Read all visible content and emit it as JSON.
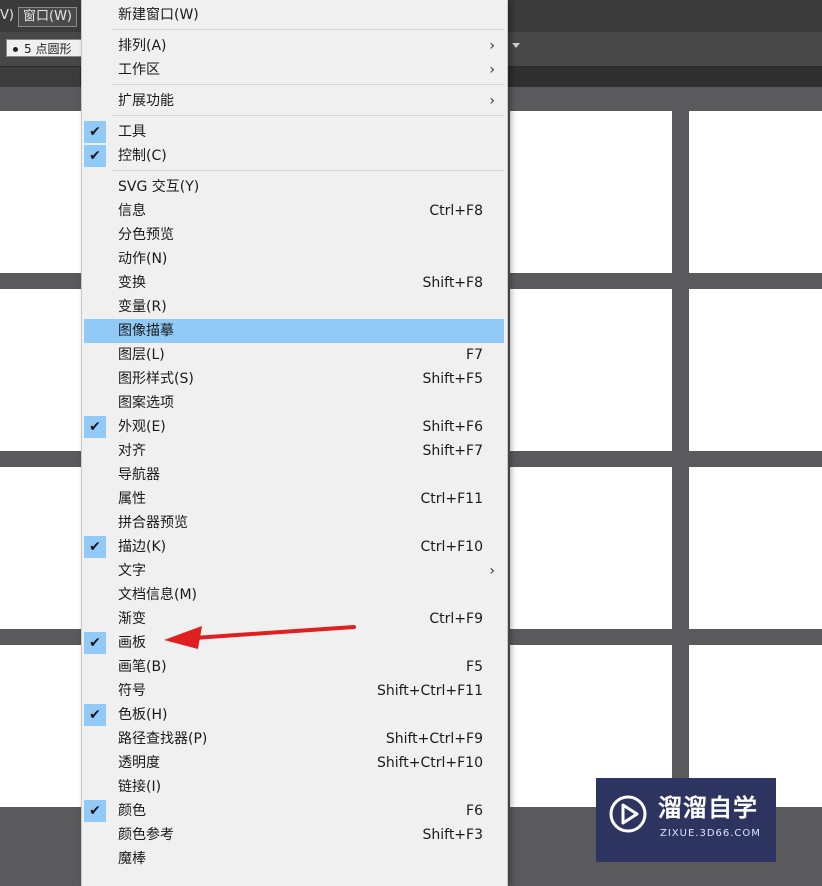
{
  "menubar": {
    "view_fragment": "V)",
    "window_label": "窗口(W)"
  },
  "controlbar": {
    "brush_label": "5 点圆形"
  },
  "menu": {
    "items": [
      {
        "label": "新建窗口(W)",
        "shortcut": "",
        "checked": false,
        "submenu": false
      },
      {
        "label": "排列(A)",
        "shortcut": "",
        "checked": false,
        "submenu": true
      },
      {
        "label": "工作区",
        "shortcut": "",
        "checked": false,
        "submenu": true
      },
      {
        "label": "扩展功能",
        "shortcut": "",
        "checked": false,
        "submenu": true
      },
      {
        "label": "工具",
        "shortcut": "",
        "checked": true,
        "submenu": false
      },
      {
        "label": "控制(C)",
        "shortcut": "",
        "checked": true,
        "submenu": false
      },
      {
        "label": "SVG 交互(Y)",
        "shortcut": "",
        "checked": false,
        "submenu": false
      },
      {
        "label": "信息",
        "shortcut": "Ctrl+F8",
        "checked": false,
        "submenu": false
      },
      {
        "label": "分色预览",
        "shortcut": "",
        "checked": false,
        "submenu": false
      },
      {
        "label": "动作(N)",
        "shortcut": "",
        "checked": false,
        "submenu": false
      },
      {
        "label": "变换",
        "shortcut": "Shift+F8",
        "checked": false,
        "submenu": false
      },
      {
        "label": "变量(R)",
        "shortcut": "",
        "checked": false,
        "submenu": false
      },
      {
        "label": "图像描摹",
        "shortcut": "",
        "checked": false,
        "submenu": false,
        "highlighted": true
      },
      {
        "label": "图层(L)",
        "shortcut": "F7",
        "checked": false,
        "submenu": false
      },
      {
        "label": "图形样式(S)",
        "shortcut": "Shift+F5",
        "checked": false,
        "submenu": false
      },
      {
        "label": "图案选项",
        "shortcut": "",
        "checked": false,
        "submenu": false
      },
      {
        "label": "外观(E)",
        "shortcut": "Shift+F6",
        "checked": true,
        "submenu": false
      },
      {
        "label": "对齐",
        "shortcut": "Shift+F7",
        "checked": false,
        "submenu": false
      },
      {
        "label": "导航器",
        "shortcut": "",
        "checked": false,
        "submenu": false
      },
      {
        "label": "属性",
        "shortcut": "Ctrl+F11",
        "checked": false,
        "submenu": false
      },
      {
        "label": "拼合器预览",
        "shortcut": "",
        "checked": false,
        "submenu": false
      },
      {
        "label": "描边(K)",
        "shortcut": "Ctrl+F10",
        "checked": true,
        "submenu": false
      },
      {
        "label": "文字",
        "shortcut": "",
        "checked": false,
        "submenu": true
      },
      {
        "label": "文档信息(M)",
        "shortcut": "",
        "checked": false,
        "submenu": false
      },
      {
        "label": "渐变",
        "shortcut": "Ctrl+F9",
        "checked": false,
        "submenu": false
      },
      {
        "label": "画板",
        "shortcut": "",
        "checked": true,
        "submenu": false
      },
      {
        "label": "画笔(B)",
        "shortcut": "F5",
        "checked": false,
        "submenu": false
      },
      {
        "label": "符号",
        "shortcut": "Shift+Ctrl+F11",
        "checked": false,
        "submenu": false
      },
      {
        "label": "色板(H)",
        "shortcut": "",
        "checked": true,
        "submenu": false
      },
      {
        "label": "路径查找器(P)",
        "shortcut": "Shift+Ctrl+F9",
        "checked": false,
        "submenu": false
      },
      {
        "label": "透明度",
        "shortcut": "Shift+Ctrl+F10",
        "checked": false,
        "submenu": false
      },
      {
        "label": "链接(I)",
        "shortcut": "",
        "checked": false,
        "submenu": false
      },
      {
        "label": "颜色",
        "shortcut": "F6",
        "checked": true,
        "submenu": false
      },
      {
        "label": "颜色参考",
        "shortcut": "Shift+F3",
        "checked": false,
        "submenu": false
      },
      {
        "label": "魔棒",
        "shortcut": "",
        "checked": false,
        "submenu": false
      }
    ],
    "check_glyph": "✔",
    "submenu_glyph": "›"
  },
  "colors": {
    "highlight": "#91c9f7",
    "annotation_arrow": "#e02020",
    "watermark_bg": "#2d3460"
  },
  "watermark": {
    "title": "溜溜自学",
    "url": "ZIXUE.3D66.COM",
    "icon": "play-icon"
  }
}
